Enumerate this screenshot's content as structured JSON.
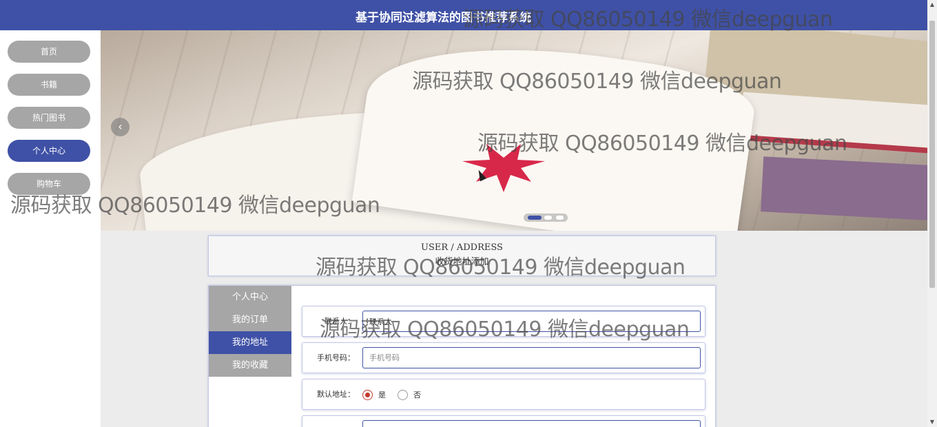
{
  "header": {
    "title": "基于协同过滤算法的图书推荐系统"
  },
  "leftnav": {
    "items": [
      {
        "label": "首页",
        "active": false
      },
      {
        "label": "书籍",
        "active": false
      },
      {
        "label": "热门图书",
        "active": false
      },
      {
        "label": "个人中心",
        "active": true
      },
      {
        "label": "购物车",
        "active": false
      }
    ]
  },
  "carousel": {
    "prev_icon": "chevron-left-icon",
    "slide_count": 3,
    "active_slide": 1
  },
  "breadcrumb": {
    "en": "USER / ADDRESS",
    "cn": "收货地址添加"
  },
  "sidemenu": {
    "items": [
      {
        "label": "个人中心",
        "active": false
      },
      {
        "label": "我的订单",
        "active": false
      },
      {
        "label": "我的地址",
        "active": true
      },
      {
        "label": "我的收藏",
        "active": false
      }
    ]
  },
  "form": {
    "contact": {
      "label": "联系人：",
      "value": "联系人"
    },
    "phone": {
      "label": "手机号码：",
      "placeholder": "手机号码"
    },
    "default_address": {
      "label": "默认地址：",
      "options": [
        {
          "label": "是",
          "checked": true
        },
        {
          "label": "否",
          "checked": false
        }
      ]
    }
  },
  "watermark": {
    "text": "源码获取 QQ86050149 微信deepguan"
  },
  "colors": {
    "primary": "#3f51a6",
    "inactive": "#a6a6a6",
    "radio_checked": "#c0392b"
  }
}
